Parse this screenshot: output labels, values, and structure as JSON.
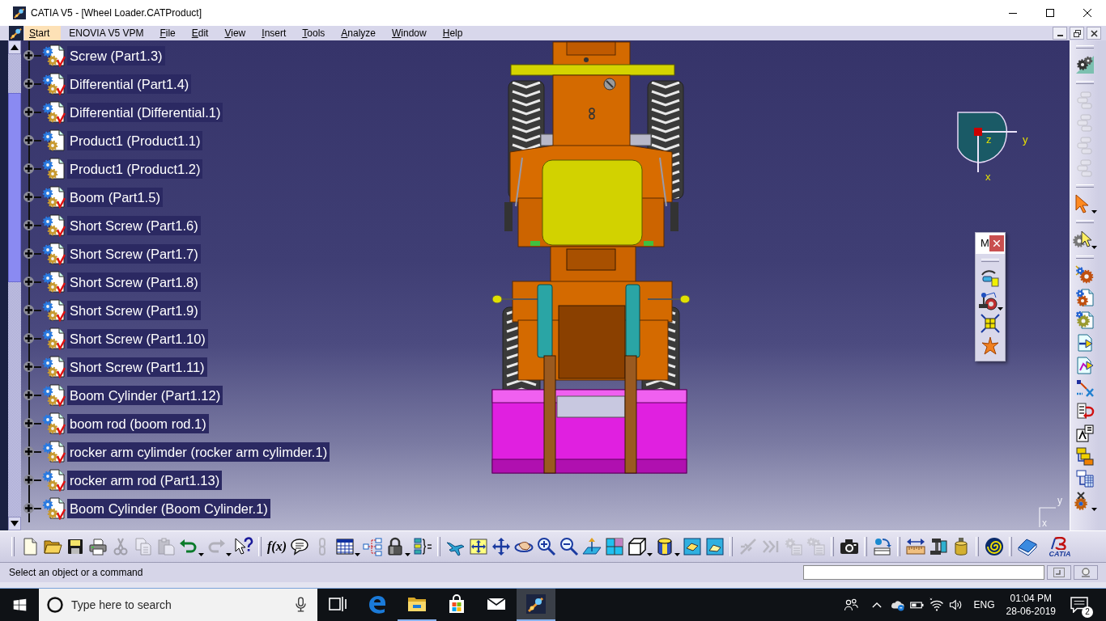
{
  "window": {
    "title": "CATIA V5 - [Wheel Loader.CATProduct]"
  },
  "menu": [
    {
      "label": "Start",
      "selected": true,
      "mnemonic": true
    },
    {
      "label": "ENOVIA V5 VPM",
      "selected": false,
      "mnemonic": false
    },
    {
      "label": "File",
      "selected": false,
      "mnemonic": true
    },
    {
      "label": "Edit",
      "selected": false,
      "mnemonic": true
    },
    {
      "label": "View",
      "selected": false,
      "mnemonic": true
    },
    {
      "label": "Insert",
      "selected": false,
      "mnemonic": true
    },
    {
      "label": "Tools",
      "selected": false,
      "mnemonic": true
    },
    {
      "label": "Analyze",
      "selected": false,
      "mnemonic": true
    },
    {
      "label": "Window",
      "selected": false,
      "mnemonic": true
    },
    {
      "label": "Help",
      "selected": false,
      "mnemonic": true
    }
  ],
  "tree": {
    "items": [
      {
        "label": "Screw (Part1.3)",
        "kind": "part",
        "expanded": false
      },
      {
        "label": "Differential (Part1.4)",
        "kind": "part",
        "expanded": false
      },
      {
        "label": "Differential (Differential.1)",
        "kind": "part",
        "expanded": false
      },
      {
        "label": "Product1 (Product1.1)",
        "kind": "product",
        "expanded": false
      },
      {
        "label": "Product1 (Product1.2)",
        "kind": "product",
        "expanded": false
      },
      {
        "label": "Boom (Part1.5)",
        "kind": "part",
        "expanded": false
      },
      {
        "label": "Short Screw (Part1.6)",
        "kind": "part",
        "expanded": false
      },
      {
        "label": "Short Screw (Part1.7)",
        "kind": "part",
        "expanded": false
      },
      {
        "label": "Short Screw (Part1.8)",
        "kind": "part",
        "expanded": false
      },
      {
        "label": "Short Screw (Part1.9)",
        "kind": "part",
        "expanded": false
      },
      {
        "label": "Short Screw (Part1.10)",
        "kind": "part",
        "expanded": false
      },
      {
        "label": "Short Screw (Part1.11)",
        "kind": "part",
        "expanded": false
      },
      {
        "label": "Boom Cylinder (Part1.12)",
        "kind": "part",
        "expanded": false
      },
      {
        "label": "boom rod (boom rod.1)",
        "kind": "part",
        "expanded": false
      },
      {
        "label": "rocker arm cylimder (rocker arm cylimder.1)",
        "kind": "part",
        "expanded": false
      },
      {
        "label": "rocker arm rod (Part1.13)",
        "kind": "part",
        "expanded": false
      },
      {
        "label": "Boom Cylinder (Boom Cylinder.1)",
        "kind": "part",
        "expanded": false
      }
    ]
  },
  "compass": {
    "labels": [
      "z",
      "y",
      "x"
    ]
  },
  "floating_toolbar": {
    "title": "M",
    "buttons": [
      {
        "kind": "tool_box",
        "disabled": false,
        "dropdown": false
      },
      {
        "kind": "joystick",
        "disabled": false,
        "dropdown": true
      },
      {
        "kind": "fit_frame",
        "disabled": false,
        "dropdown": false
      },
      {
        "kind": "star",
        "disabled": false,
        "dropdown": false
      }
    ]
  },
  "mini_axis": {
    "labels": [
      "y",
      "x"
    ]
  },
  "right_toolbar": {
    "groups": [
      {
        "buttons": [
          {
            "kind": "gears",
            "disabled": false,
            "dropdown": false
          }
        ]
      },
      {
        "buttons": [
          {
            "kind": "stack",
            "disabled": true,
            "dropdown": false
          },
          {
            "kind": "stack",
            "disabled": true,
            "dropdown": false
          },
          {
            "kind": "stack",
            "disabled": true,
            "dropdown": false
          },
          {
            "kind": "stack",
            "disabled": true,
            "dropdown": false
          }
        ]
      },
      {
        "buttons": [
          {
            "kind": "select",
            "disabled": false,
            "dropdown": true
          }
        ]
      },
      {
        "buttons": [
          {
            "kind": "gear_cursor",
            "disabled": false,
            "dropdown": true
          }
        ]
      },
      {
        "buttons": [
          {
            "kind": "gear_spark",
            "disabled": false,
            "dropdown": false
          },
          {
            "kind": "gear_page",
            "disabled": false,
            "dropdown": false
          },
          {
            "kind": "gear_doc",
            "disabled": false,
            "dropdown": false
          },
          {
            "kind": "page_arrow",
            "disabled": false,
            "dropdown": false
          },
          {
            "kind": "page_link",
            "disabled": false,
            "dropdown": false
          },
          {
            "kind": "node_cross",
            "disabled": false,
            "dropdown": false
          },
          {
            "kind": "list_undo",
            "disabled": false,
            "dropdown": false
          },
          {
            "kind": "text_boxes",
            "disabled": false,
            "dropdown": false
          },
          {
            "kind": "stacked_cards",
            "disabled": false,
            "dropdown": false
          },
          {
            "kind": "tree_grid",
            "disabled": false,
            "dropdown": false
          },
          {
            "kind": "gear_cross",
            "disabled": false,
            "dropdown": true
          }
        ]
      }
    ]
  },
  "bottom_toolbar": {
    "groups": [
      {
        "buttons": [
          {
            "kind": "new",
            "disabled": false,
            "dropdown": false
          },
          {
            "kind": "open",
            "disabled": false,
            "dropdown": false
          },
          {
            "kind": "save",
            "disabled": false,
            "dropdown": false
          },
          {
            "kind": "print",
            "disabled": false,
            "dropdown": false
          },
          {
            "kind": "cut",
            "disabled": true,
            "dropdown": false
          },
          {
            "kind": "copy",
            "disabled": true,
            "dropdown": false
          },
          {
            "kind": "paste",
            "disabled": true,
            "dropdown": false
          },
          {
            "kind": "undo",
            "disabled": false,
            "dropdown": true
          },
          {
            "kind": "redo",
            "disabled": true,
            "dropdown": true
          },
          {
            "kind": "help_cursor",
            "disabled": false,
            "dropdown": false
          }
        ]
      },
      {
        "buttons": [
          {
            "kind": "formula",
            "label": "f(x)",
            "disabled": false,
            "dropdown": false
          },
          {
            "kind": "comment",
            "disabled": false,
            "dropdown": false
          },
          {
            "kind": "chain",
            "disabled": true,
            "dropdown": false
          },
          {
            "kind": "table",
            "disabled": false,
            "dropdown": true
          },
          {
            "kind": "graph",
            "disabled": false,
            "dropdown": false
          },
          {
            "kind": "lock",
            "disabled": false,
            "dropdown": true
          },
          {
            "kind": "equations",
            "disabled": false,
            "dropdown": false
          }
        ]
      },
      {
        "buttons": [
          {
            "kind": "fly",
            "disabled": false,
            "dropdown": false
          },
          {
            "kind": "fit_all",
            "disabled": false,
            "dropdown": false
          },
          {
            "kind": "pan",
            "disabled": false,
            "dropdown": false
          },
          {
            "kind": "rotate",
            "disabled": false,
            "dropdown": false
          },
          {
            "kind": "zoom_in",
            "disabled": false,
            "dropdown": false
          },
          {
            "kind": "zoom_out",
            "disabled": false,
            "dropdown": false
          },
          {
            "kind": "normal_view",
            "disabled": false,
            "dropdown": false
          },
          {
            "kind": "multi_view",
            "disabled": false,
            "dropdown": false
          },
          {
            "kind": "iso_view",
            "disabled": false,
            "dropdown": true
          },
          {
            "kind": "shading",
            "disabled": false,
            "dropdown": true
          },
          {
            "kind": "hide_show",
            "disabled": false,
            "dropdown": false
          },
          {
            "kind": "swap_view",
            "disabled": false,
            "dropdown": false
          }
        ]
      },
      {
        "buttons": [
          {
            "kind": "branch",
            "disabled": true,
            "dropdown": false
          },
          {
            "kind": "chevrons",
            "disabled": true,
            "dropdown": false
          },
          {
            "kind": "gear_sheet",
            "disabled": true,
            "dropdown": false
          },
          {
            "kind": "gears_sheet",
            "disabled": true,
            "dropdown": false
          }
        ]
      },
      {
        "buttons": [
          {
            "kind": "camera",
            "disabled": false,
            "dropdown": false
          }
        ]
      },
      {
        "buttons": [
          {
            "kind": "ball_box",
            "disabled": false,
            "dropdown": false
          }
        ]
      },
      {
        "buttons": [
          {
            "kind": "ruler",
            "disabled": false,
            "dropdown": false
          },
          {
            "kind": "clamp",
            "disabled": false,
            "dropdown": false
          },
          {
            "kind": "weight",
            "disabled": false,
            "dropdown": false
          }
        ]
      },
      {
        "buttons": [
          {
            "kind": "spiral",
            "disabled": false,
            "dropdown": false
          }
        ]
      },
      {
        "buttons": [
          {
            "kind": "book",
            "disabled": false,
            "dropdown": false
          },
          {
            "kind": "brand_logo",
            "label": "CATIA",
            "disabled": false,
            "dropdown": false
          }
        ]
      }
    ]
  },
  "status_bar": {
    "message": "Select an object or a command"
  },
  "taskbar": {
    "search": {
      "placeholder": "Type here to search"
    },
    "apps": [
      {
        "kind": "task_view",
        "running": false,
        "selected": false
      },
      {
        "kind": "edge",
        "running": false,
        "selected": false
      },
      {
        "kind": "explorer",
        "running": true,
        "selected": false
      },
      {
        "kind": "store",
        "running": false,
        "selected": false
      },
      {
        "kind": "mail",
        "running": false,
        "selected": false
      },
      {
        "kind": "catia",
        "running": true,
        "selected": true
      }
    ],
    "language": "ENG",
    "time": "01:04 PM",
    "date": "28-06-2019",
    "notifications": "2"
  }
}
